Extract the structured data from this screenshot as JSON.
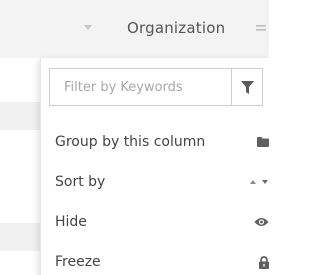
{
  "header": {
    "column_title": "Organization",
    "sort_caret_icon": "caret-down-icon",
    "menu_icon": "menu-lines-icon"
  },
  "menu": {
    "filter": {
      "placeholder": "Filter by Keywords",
      "value": "",
      "icon": "filter-funnel-icon"
    },
    "items": [
      {
        "label": "Group by this column",
        "icon": "folder-icon"
      },
      {
        "label": "Sort by",
        "icon": "sort-arrows-icon"
      },
      {
        "label": "Hide",
        "icon": "eye-icon"
      },
      {
        "label": "Freeze",
        "icon": "lock-icon"
      }
    ]
  },
  "colors": {
    "header_bg": "#f3f3f3",
    "text": "#444444",
    "icon": "#555555",
    "border": "#cfcfcf"
  }
}
